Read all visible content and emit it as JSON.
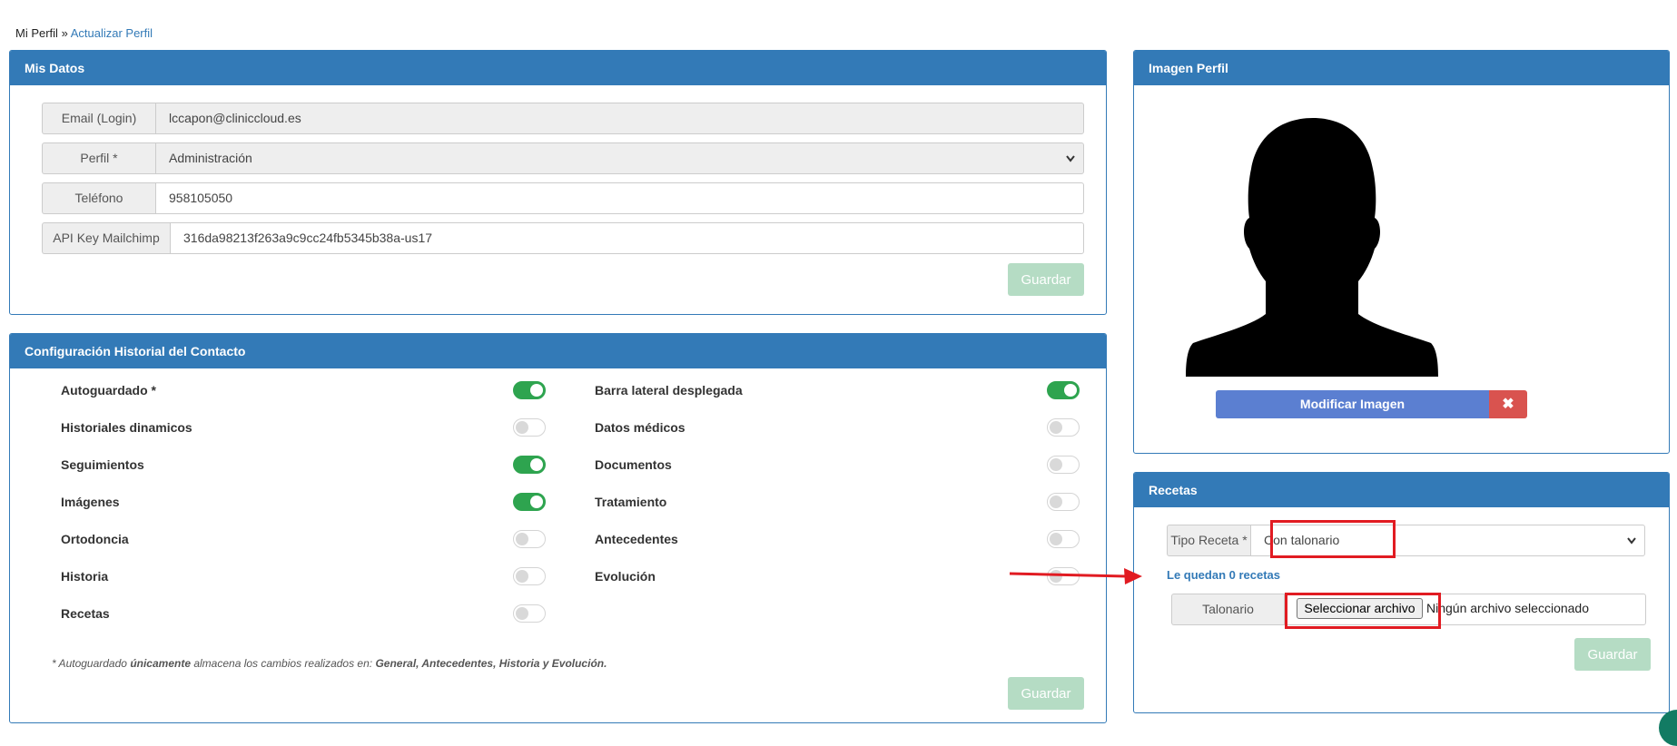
{
  "breadcrumb": {
    "root": "Mi Perfil",
    "separator": "»",
    "current": "Actualizar Perfil"
  },
  "mis_datos": {
    "title": "Mis Datos",
    "email_label": "Email (Login)",
    "email_value": "lccapon@cliniccloud.es",
    "perfil_label": "Perfil *",
    "perfil_value": "Administración",
    "telefono_label": "Teléfono",
    "telefono_value": "958105050",
    "api_label": "API Key Mailchimp",
    "api_value": "316da98213f263a9c9cc24fb5345b38a-us17",
    "save_label": "Guardar"
  },
  "historial": {
    "title": "Configuración Historial del Contacto",
    "left": [
      {
        "label": "Autoguardado *",
        "on": true
      },
      {
        "label": "Historiales dinamicos",
        "on": false
      },
      {
        "label": "Seguimientos",
        "on": true
      },
      {
        "label": "Imágenes",
        "on": true
      },
      {
        "label": "Ortodoncia",
        "on": false
      },
      {
        "label": "Historia",
        "on": false
      },
      {
        "label": "Recetas",
        "on": false
      }
    ],
    "right": [
      {
        "label": "Barra lateral desplegada",
        "on": true
      },
      {
        "label": "Datos médicos",
        "on": false
      },
      {
        "label": "Documentos",
        "on": false
      },
      {
        "label": "Tratamiento",
        "on": false
      },
      {
        "label": "Antecedentes",
        "on": false
      },
      {
        "label": "Evolución",
        "on": false
      }
    ],
    "note_prefix": "* Autoguardado",
    "note_em": "únicamente",
    "note_mid": "almacena los cambios realizados en:",
    "note_list": "General, Antecedentes, Historia y Evolución.",
    "save_label": "Guardar"
  },
  "imagen": {
    "title": "Imagen Perfil",
    "modify_label": "Modificar Imagen",
    "delete_icon": "✖"
  },
  "recetas": {
    "title": "Recetas",
    "tipo_label": "Tipo Receta *",
    "tipo_value": "Con talonario",
    "quedan_text": "Le quedan 0 recetas",
    "talonario_label": "Talonario",
    "file_button": "Seleccionar archivo",
    "file_status": "Ningún archivo seleccionado",
    "save_label": "Guardar"
  },
  "icons": {
    "caret": "⌄"
  },
  "colors": {
    "primary": "#337ab7",
    "toggle_on": "#2ea44f",
    "annotation": "#e11b22"
  }
}
